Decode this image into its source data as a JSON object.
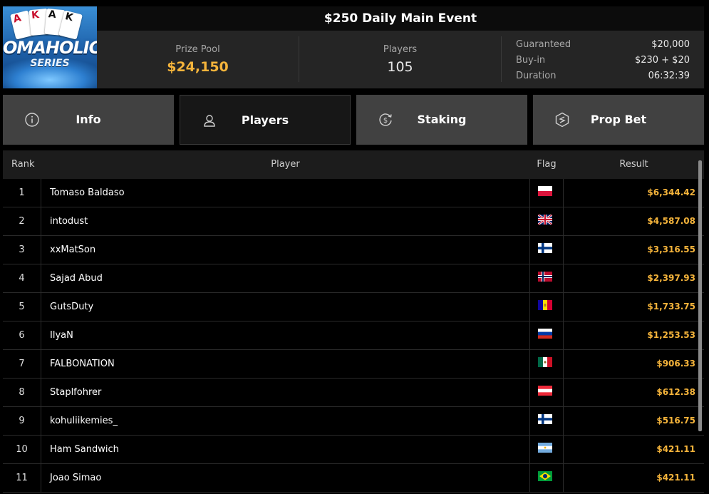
{
  "logo": {
    "cards": [
      "A",
      "K",
      "A",
      "K"
    ],
    "wordmark": "OMAHOLIC",
    "subtitle": "SERIES"
  },
  "header": {
    "title": "$250 Daily Main Event",
    "prize_pool_label": "Prize Pool",
    "prize_pool_value": "$24,150",
    "players_label": "Players",
    "players_value": "105",
    "info": [
      {
        "label": "Guaranteed",
        "value": "$20,000"
      },
      {
        "label": "Buy-in",
        "value": "$230 + $20"
      },
      {
        "label": "Duration",
        "value": "06:32:39"
      }
    ]
  },
  "tabs": [
    {
      "label": "Info",
      "icon": "info-icon",
      "active": false
    },
    {
      "label": "Players",
      "icon": "user-icon",
      "active": true
    },
    {
      "label": "Staking",
      "icon": "staking-icon",
      "active": false
    },
    {
      "label": "Prop Bet",
      "icon": "prop-bet-icon",
      "active": false
    }
  ],
  "table": {
    "headers": {
      "rank": "Rank",
      "player": "Player",
      "flag": "Flag",
      "result": "Result"
    },
    "rows": [
      {
        "rank": "1",
        "player": "Tomaso Baldaso",
        "flag": "poland",
        "result": "$6,344.42"
      },
      {
        "rank": "2",
        "player": "intodust",
        "flag": "united-kingdom",
        "result": "$4,587.08"
      },
      {
        "rank": "3",
        "player": "xxMatSon",
        "flag": "finland",
        "result": "$3,316.55"
      },
      {
        "rank": "4",
        "player": "Sajad Abud",
        "flag": "norway",
        "result": "$2,397.93"
      },
      {
        "rank": "5",
        "player": "GutsDuty",
        "flag": "andorra",
        "result": "$1,733.75"
      },
      {
        "rank": "6",
        "player": "IlyaN",
        "flag": "russia",
        "result": "$1,253.53"
      },
      {
        "rank": "7",
        "player": "FALBONATION",
        "flag": "mexico",
        "result": "$906.33"
      },
      {
        "rank": "8",
        "player": "Staplfohrer",
        "flag": "austria",
        "result": "$612.38"
      },
      {
        "rank": "9",
        "player": "kohuliikemies_",
        "flag": "finland",
        "result": "$516.75"
      },
      {
        "rank": "10",
        "player": "Ham Sandwich",
        "flag": "argentina",
        "result": "$421.11"
      },
      {
        "rank": "11",
        "player": "Joao Simao",
        "flag": "brazil",
        "result": "$421.11"
      }
    ]
  },
  "colors": {
    "accent": "#f5b43b",
    "tab_bg": "#414141",
    "tab_active_bg": "#171717"
  }
}
